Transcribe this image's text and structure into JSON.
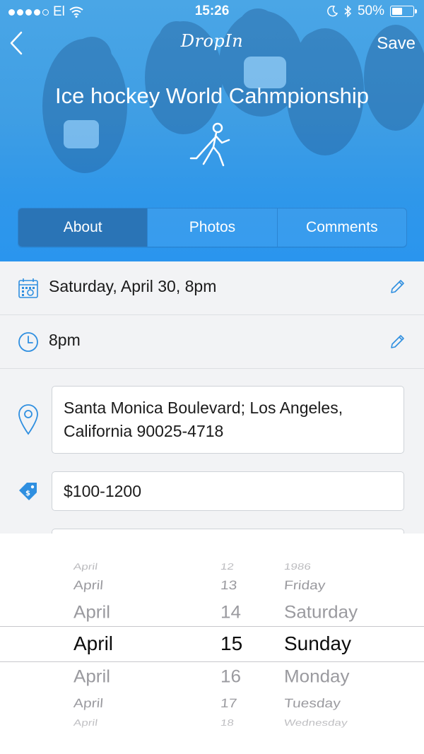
{
  "status_bar": {
    "carrier": "El",
    "time": "15:26",
    "battery": "50%",
    "battery_level": 0.5
  },
  "nav": {
    "brand": "DropIn",
    "save_label": "Save"
  },
  "event": {
    "title": "Ice hockey World Cahmpionship"
  },
  "tabs": [
    {
      "label": "About",
      "active": true
    },
    {
      "label": "Photos",
      "active": false
    },
    {
      "label": "Comments",
      "active": false
    }
  ],
  "details": {
    "date": "Saturday, April 30, 8pm",
    "time": "8pm",
    "address_line1": "Santa Monica Boulevard; Los Angeles,",
    "address_line2": "California 90025-4718",
    "price": "$100-1200"
  },
  "picker": {
    "months": [
      "April",
      "April",
      "April",
      "April",
      "April",
      "April",
      "April"
    ],
    "days": [
      "12",
      "13",
      "14",
      "15",
      "16",
      "17",
      "18"
    ],
    "weekdays": [
      "1986",
      "Friday",
      "Saturday",
      "Sunday",
      "Monday",
      "Tuesday",
      "Wednesday"
    ]
  },
  "colors": {
    "header_blue": "#3f9ee4",
    "active_tab": "#2a74b6",
    "icon_blue": "#2f8fe0"
  }
}
